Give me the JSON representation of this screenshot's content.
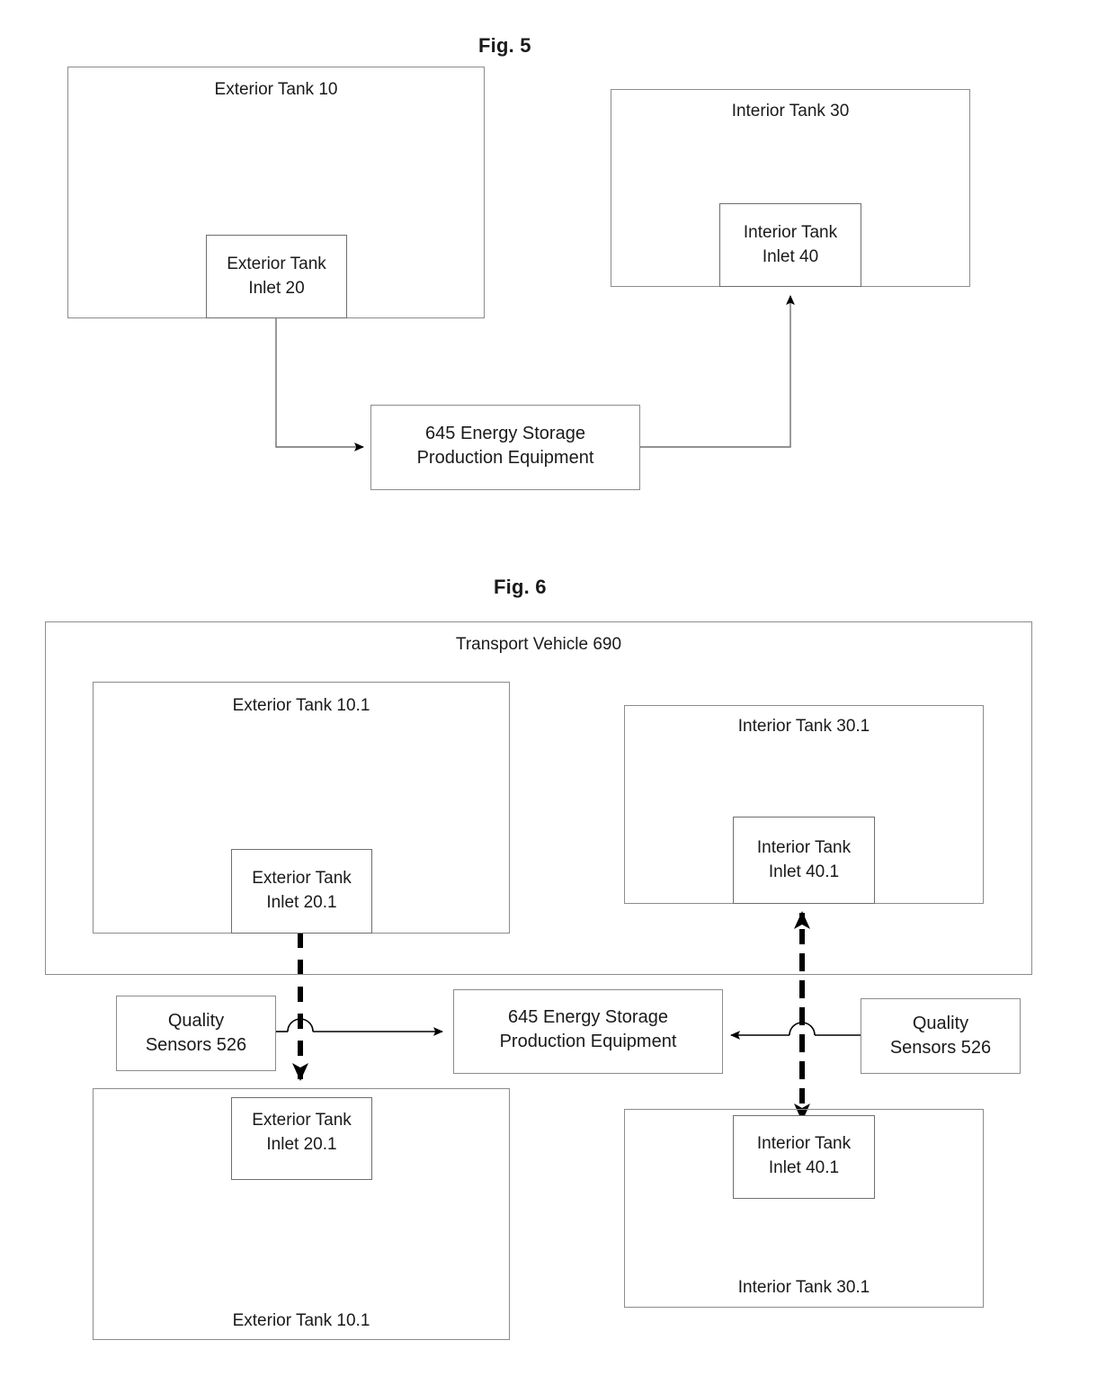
{
  "figures": [
    {
      "id": "fig5",
      "title": "Fig. 5",
      "blocks": {
        "exterior_tank": "Exterior Tank 10",
        "exterior_tank_inlet": "Exterior Tank\nInlet 20",
        "interior_tank": "Interior Tank 30",
        "interior_tank_inlet": "Interior Tank\nInlet 40",
        "equipment": "645 Energy Storage\nProduction Equipment"
      }
    },
    {
      "id": "fig6",
      "title": "Fig. 6",
      "blocks": {
        "transport_vehicle": "Transport Vehicle 690",
        "exterior_tank_top": "Exterior Tank 10.1",
        "exterior_tank_inlet_top": "Exterior Tank\nInlet 20.1",
        "interior_tank_top": "Interior Tank 30.1",
        "interior_tank_inlet_top": "Interior Tank\nInlet 40.1",
        "quality_sensors_left": "Quality\nSensors 526",
        "equipment": "645 Energy Storage\nProduction Equipment",
        "quality_sensors_right": "Quality\nSensors 526",
        "exterior_tank_inlet_bottom": "Exterior Tank\nInlet 20.1",
        "exterior_tank_bottom": "Exterior Tank 10.1",
        "interior_tank_inlet_bottom": "Interior Tank\nInlet 40.1",
        "interior_tank_bottom": "Interior Tank 30.1"
      }
    }
  ],
  "colors": {
    "line": "#6e6e6e",
    "box_border": "#8c8c8c",
    "text": "#1a1a1a",
    "arrow": "#000000"
  }
}
